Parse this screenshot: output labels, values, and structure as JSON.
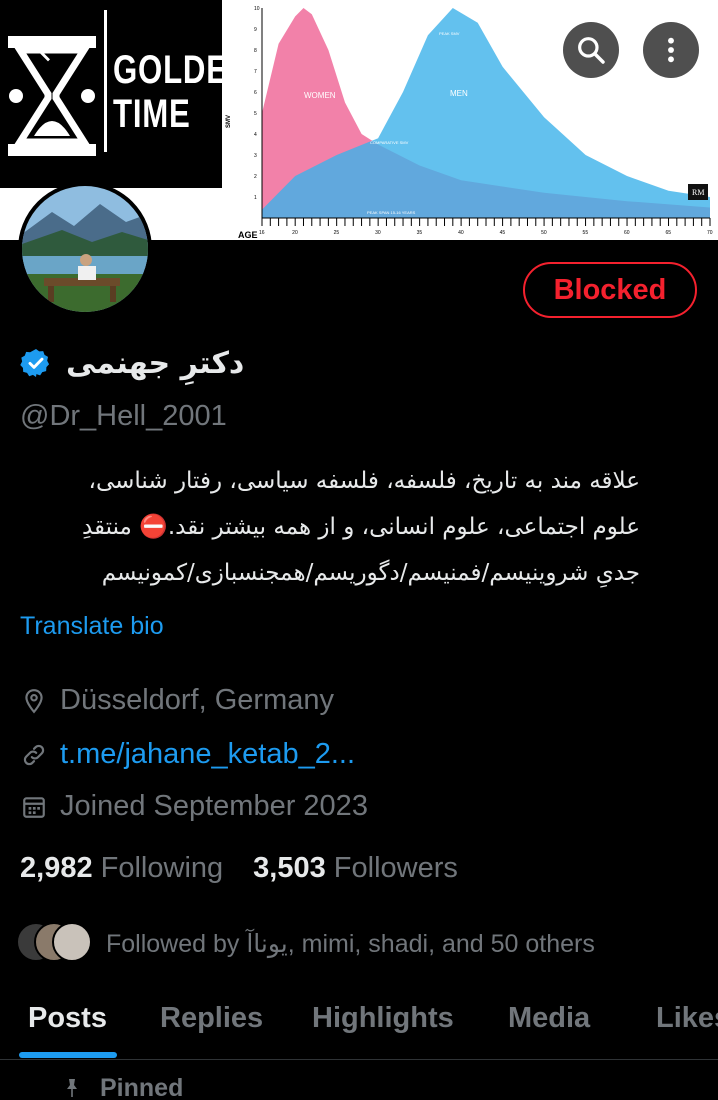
{
  "banner": {
    "brand_line1": "GOLDEN",
    "brand_line2": "TIME",
    "chart_labels": {
      "women": "WOMEN",
      "men": "MEN",
      "peak_smv_left": "PEAK SMV",
      "peak_smv_right": "PEAK SMV",
      "comparative": "COMPARATIVE SMV",
      "peak_span": "PEAK SPAN 15-16 YEARS",
      "yaxis": "SMV",
      "xaxis_title": "AGE",
      "brand_mark": "RM"
    },
    "colors": {
      "women": "#f06b9a",
      "men": "#3cb2ea",
      "overlap": "#7b82e6"
    }
  },
  "chart_data": {
    "type": "area",
    "xlabel": "AGE",
    "ylabel": "SMV",
    "ylim": [
      0,
      10
    ],
    "xlim": [
      16,
      70
    ],
    "yticks": [
      1,
      2,
      3,
      4,
      5,
      6,
      7,
      8,
      9,
      10
    ],
    "xticks": [
      16,
      20,
      25,
      30,
      35,
      40,
      45,
      50,
      55,
      60,
      65,
      70
    ],
    "series": [
      {
        "name": "WOMEN",
        "x": [
          16,
          18,
          20,
          21,
          22,
          24,
          26,
          28,
          30,
          35,
          40,
          50,
          60,
          70
        ],
        "values": [
          5.0,
          8.3,
          9.6,
          10.0,
          9.7,
          8.0,
          5.5,
          4.0,
          3.5,
          2.5,
          1.8,
          1.2,
          0.8,
          0.5
        ]
      },
      {
        "name": "MEN",
        "x": [
          16,
          20,
          25,
          30,
          33,
          36,
          39,
          42,
          45,
          50,
          55,
          60,
          65,
          70
        ],
        "values": [
          0.4,
          2.0,
          3.0,
          3.8,
          6.0,
          8.7,
          10.0,
          9.3,
          7.2,
          4.8,
          3.0,
          2.0,
          1.3,
          1.0
        ]
      }
    ],
    "annotations": [
      "PEAK SMV",
      "COMPARATIVE SMV",
      "PEAK SPAN 15-16 YEARS"
    ]
  },
  "header": {
    "back_icon": "arrow-left-icon",
    "search_icon": "search-icon",
    "more_icon": "more-vertical-icon"
  },
  "profile": {
    "blocked_label": "Blocked",
    "display_name": "دکترِ جهنمی",
    "verified_icon": "verified-badge-icon",
    "handle": "@Dr_Hell_2001",
    "bio_line1": "علاقه مند به تاریخ، فلسفه، فلسفه سیاسی، رفتار شناسی،",
    "bio_line2": "علوم اجتماعی، علوم انسانی، و از همه بیشتر نقد.⛔ منتقدِ",
    "bio_line3": "جدیِ شروینیسم/فمنیسم/دگوریسم/همجنسبازی/کمونیسم",
    "translate_label": "Translate bio",
    "location": "Düsseldorf, Germany",
    "link": "t.me/jahane_ketab_2...",
    "joined": "Joined September 2023",
    "following_count": "2,982",
    "following_label": "Following",
    "followers_count": "3,503",
    "followers_label": "Followers",
    "followed_by": "Followed by یوناآ, mimi, shadi, and 50 others"
  },
  "tabs": [
    {
      "label": "Posts",
      "active": true
    },
    {
      "label": "Replies"
    },
    {
      "label": "Highlights"
    },
    {
      "label": "Media"
    },
    {
      "label": "Likes"
    }
  ],
  "feed": {
    "pinned_label": "Pinned",
    "pin_icon": "pin-icon"
  },
  "theme": {
    "accent": "#1d9bf0",
    "danger": "#f4212e",
    "muted": "#71767b",
    "text": "#e7e9ea"
  }
}
